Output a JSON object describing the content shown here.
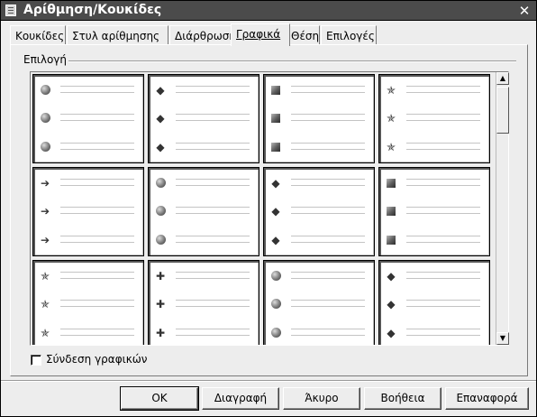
{
  "window": {
    "title": "Αρίθμηση/Κουκίδες",
    "close_glyph": "✕"
  },
  "tabs": [
    {
      "label": "Κουκίδες"
    },
    {
      "label": "Στυλ αρίθμησης"
    },
    {
      "label": "Διάρθρωση"
    },
    {
      "label": "Γραφικά",
      "active": true
    },
    {
      "label": "Θέση"
    },
    {
      "label": "Επιλογές"
    }
  ],
  "selection": {
    "group_label": "Επιλογή",
    "columns": 4,
    "visible_rows": 3,
    "cells": [
      {
        "bullet": "ball-icon",
        "glyph": ""
      },
      {
        "bullet": "diamond-icon",
        "glyph": "◆"
      },
      {
        "bullet": "square-icon",
        "glyph": ""
      },
      {
        "bullet": "star-icon",
        "glyph": "✯"
      },
      {
        "bullet": "arrow-icon",
        "glyph": "➔"
      },
      {
        "bullet": "ball-icon",
        "glyph": ""
      },
      {
        "bullet": "diamond-icon",
        "glyph": "◆"
      },
      {
        "bullet": "square-icon",
        "glyph": ""
      },
      {
        "bullet": "star-icon",
        "glyph": "✯"
      },
      {
        "bullet": "arrow-icon",
        "glyph": "✚"
      },
      {
        "bullet": "ball-icon",
        "glyph": ""
      },
      {
        "bullet": "diamond-icon",
        "glyph": "◆"
      }
    ]
  },
  "scrollbar": {
    "up_glyph": "▲",
    "down_glyph": "▼"
  },
  "link_graphics": {
    "label": "Σύνδεση γραφικών",
    "checked": false
  },
  "buttons": {
    "ok": "ΟΚ",
    "delete": "Διαγραφή",
    "cancel": "Άκυρο",
    "help": "Βοήθεια",
    "reset": "Επαναφορά"
  }
}
